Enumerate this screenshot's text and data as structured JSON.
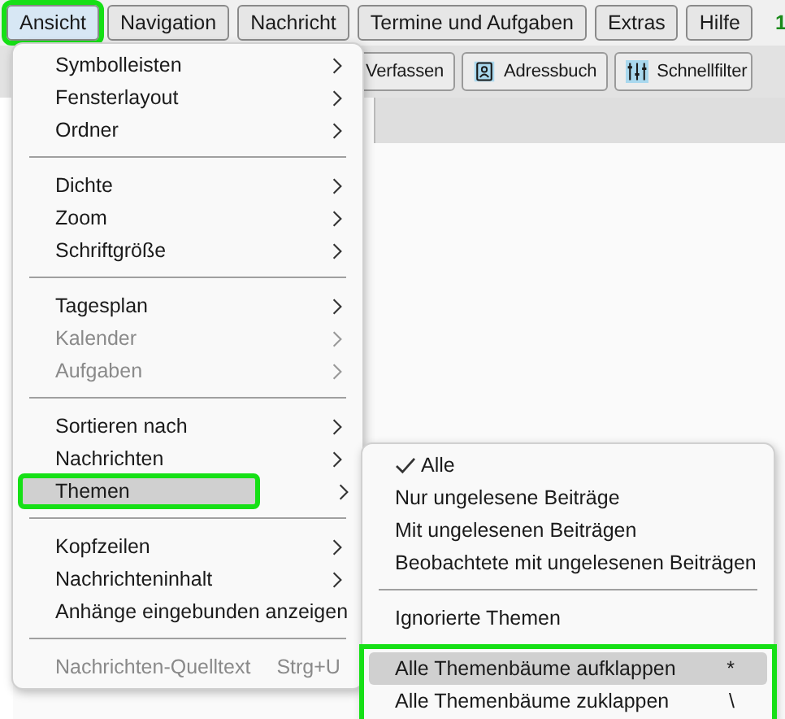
{
  "menubar": [
    {
      "label": "Ansicht",
      "selected": true,
      "outlined": true
    },
    {
      "label": "Navigation",
      "selected": false,
      "outlined": false
    },
    {
      "label": "Nachricht",
      "selected": false,
      "outlined": false
    },
    {
      "label": "Termine und Aufgaben",
      "selected": false,
      "outlined": false
    },
    {
      "label": "Extras",
      "selected": false,
      "outlined": false
    },
    {
      "label": "Hilfe",
      "selected": false,
      "outlined": false
    }
  ],
  "menubar_count": "1",
  "toolbar": [
    {
      "label": "Verfassen",
      "kind": "plain"
    },
    {
      "label": "Adressbuch",
      "kind": "addressbook"
    },
    {
      "label": "Schnellfilter",
      "kind": "filter"
    }
  ],
  "menu": {
    "sections": [
      {
        "items": [
          {
            "label": "Symbolleisten",
            "submenu": true,
            "disabled": false,
            "hovered": false,
            "outlined": false
          },
          {
            "label": "Fensterlayout",
            "submenu": true,
            "disabled": false,
            "hovered": false,
            "outlined": false
          },
          {
            "label": "Ordner",
            "submenu": true,
            "disabled": false,
            "hovered": false,
            "outlined": false
          }
        ]
      },
      {
        "items": [
          {
            "label": "Dichte",
            "submenu": true,
            "disabled": false,
            "hovered": false,
            "outlined": false
          },
          {
            "label": "Zoom",
            "submenu": true,
            "disabled": false,
            "hovered": false,
            "outlined": false
          },
          {
            "label": "Schriftgröße",
            "submenu": true,
            "disabled": false,
            "hovered": false,
            "outlined": false
          }
        ]
      },
      {
        "items": [
          {
            "label": "Tagesplan",
            "submenu": true,
            "disabled": false,
            "hovered": false,
            "outlined": false
          },
          {
            "label": "Kalender",
            "submenu": true,
            "disabled": true,
            "hovered": false,
            "outlined": false
          },
          {
            "label": "Aufgaben",
            "submenu": true,
            "disabled": true,
            "hovered": false,
            "outlined": false
          }
        ]
      },
      {
        "items": [
          {
            "label": "Sortieren nach",
            "submenu": true,
            "disabled": false,
            "hovered": false,
            "outlined": false
          },
          {
            "label": "Nachrichten",
            "submenu": true,
            "disabled": false,
            "hovered": false,
            "outlined": false
          },
          {
            "label": "Themen",
            "submenu": true,
            "disabled": false,
            "hovered": true,
            "outlined": true
          }
        ]
      },
      {
        "items": [
          {
            "label": "Kopfzeilen",
            "submenu": true,
            "disabled": false,
            "hovered": false,
            "outlined": false
          },
          {
            "label": "Nachrichteninhalt",
            "submenu": true,
            "disabled": false,
            "hovered": false,
            "outlined": false
          },
          {
            "label": "Anhänge eingebunden anzeigen",
            "submenu": false,
            "disabled": false,
            "hovered": false,
            "outlined": false
          }
        ]
      },
      {
        "items": [
          {
            "label": "Nachrichten-Quelltext",
            "shortcut": "Strg+U",
            "submenu": false,
            "disabled": true,
            "hovered": false,
            "outlined": false
          }
        ]
      }
    ]
  },
  "submenu": {
    "sections": [
      {
        "separator_before": false,
        "outlined": false,
        "items": [
          {
            "label": "Alle",
            "checked": true,
            "hovered": false
          },
          {
            "label": "Nur ungelesene Beiträge",
            "checked": false,
            "hovered": false
          },
          {
            "label": "Mit ungelesenen Beiträgen",
            "checked": false,
            "hovered": false
          },
          {
            "label": "Beobachtete mit ungelesenen Beiträgen",
            "checked": false,
            "hovered": false
          }
        ]
      },
      {
        "separator_before": true,
        "outlined": false,
        "items": [
          {
            "label": "Ignorierte Themen",
            "checked": false,
            "hovered": false
          }
        ]
      },
      {
        "separator_before": false,
        "outlined": true,
        "items": [
          {
            "label": "Alle Themenbäume aufklappen",
            "shortcut": "*",
            "checked": false,
            "hovered": true
          },
          {
            "label": "Alle Themenbäume zuklappen",
            "shortcut": "\\",
            "checked": false,
            "hovered": false
          }
        ]
      }
    ]
  }
}
